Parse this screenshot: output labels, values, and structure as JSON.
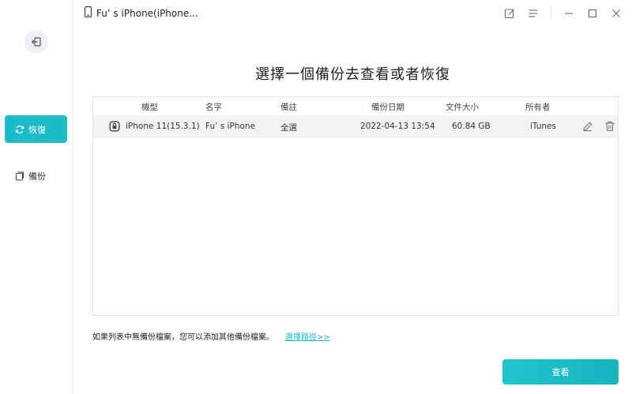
{
  "window": {
    "device_title": "Fu’ s iPhone(iPhone..."
  },
  "sidebar": {
    "items": [
      {
        "label": "恢復",
        "icon": "refresh-icon",
        "active": true
      },
      {
        "label": "備份",
        "icon": "copy-icon",
        "active": false
      }
    ]
  },
  "main": {
    "heading": "選擇一個備份去查看或者恢復",
    "table": {
      "columns": [
        "機型",
        "名字",
        "備註",
        "備份日期",
        "文件大小",
        "所有者"
      ],
      "rows": [
        {
          "model": "iPhone 11(15.3.1)",
          "name": "Fu’ s iPhone",
          "note": "全選",
          "date": "2022-04-13 13:54",
          "size": "60.84 GB",
          "owner": "iTunes"
        }
      ]
    },
    "footer_note": "如果列表中無備份檔案，您可以添加其他備份檔案。",
    "footer_link": "選擇路徑>>",
    "view_button": "查看"
  },
  "colors": {
    "accent": "#1cbcc6",
    "link": "#19b7c4"
  }
}
